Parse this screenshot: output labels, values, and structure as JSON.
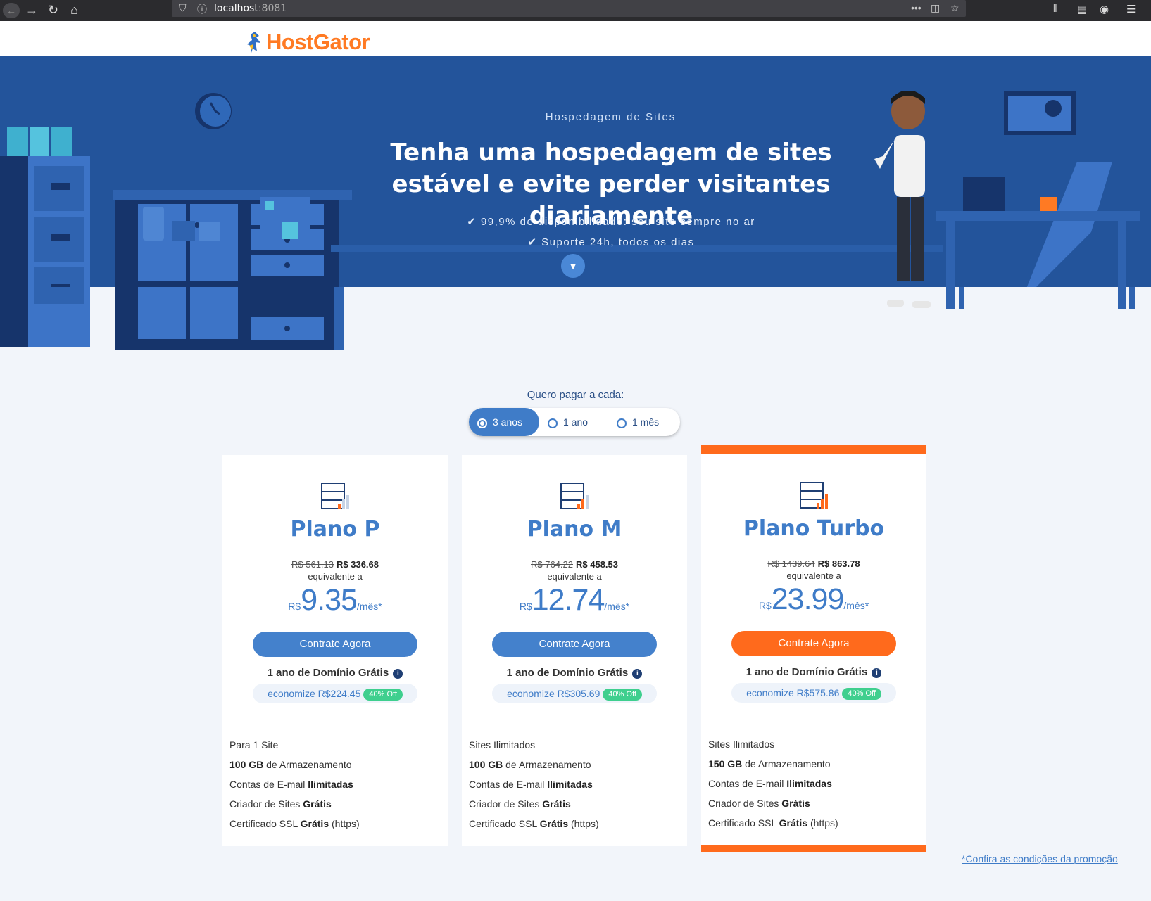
{
  "browser": {
    "url_host": "localhost",
    "url_port": ":8081"
  },
  "logo": {
    "text": "HostGator"
  },
  "hero": {
    "subtitle": "Hospedagem de Sites",
    "title": "Tenha uma hospedagem de sites estável e evite perder visitantes diariamente",
    "features": [
      "99,9% de disponibilidade: seu site sempre no ar",
      "Suporte 24h, todos os dias"
    ]
  },
  "billing": {
    "label": "Quero pagar a cada:",
    "options": [
      "3 anos",
      "1 ano",
      "1 mês"
    ],
    "selected": "3 anos"
  },
  "plans": [
    {
      "name": "Plano P",
      "old_price": "R$ 561.13",
      "new_price": "R$ 336.68",
      "equiv": "equivalente a",
      "currency": "R$",
      "monthly": "9.35",
      "per": "/mês*",
      "cta": "Contrate Agora",
      "domain": "1 ano de Domínio Grátis",
      "save": "economize R$224.45",
      "badge": "40% Off",
      "features": [
        {
          "pre": "Para 1 Site",
          "bold": "",
          "post": ""
        },
        {
          "pre": "",
          "bold": "100 GB",
          "post": " de Armazenamento"
        },
        {
          "pre": "Contas de E-mail ",
          "bold": "Ilimitadas",
          "post": ""
        },
        {
          "pre": "Criador de Sites ",
          "bold": "Grátis",
          "post": ""
        },
        {
          "pre": "Certificado SSL ",
          "bold": "Grátis",
          "post": " (https)"
        }
      ]
    },
    {
      "name": "Plano M",
      "old_price": "R$ 764.22",
      "new_price": "R$ 458.53",
      "equiv": "equivalente a",
      "currency": "R$",
      "monthly": "12.74",
      "per": "/mês*",
      "cta": "Contrate Agora",
      "domain": "1 ano de Domínio Grátis",
      "save": "economize R$305.69",
      "badge": "40% Off",
      "features": [
        {
          "pre": "Sites Ilimitados",
          "bold": "",
          "post": ""
        },
        {
          "pre": "",
          "bold": "100 GB",
          "post": " de Armazenamento"
        },
        {
          "pre": "Contas de E-mail ",
          "bold": "Ilimitadas",
          "post": ""
        },
        {
          "pre": "Criador de Sites ",
          "bold": "Grátis",
          "post": ""
        },
        {
          "pre": "Certificado SSL ",
          "bold": "Grátis",
          "post": " (https)"
        }
      ]
    },
    {
      "name": "Plano Turbo",
      "old_price": "R$ 1439.64",
      "new_price": "R$ 863.78",
      "equiv": "equivalente a",
      "currency": "R$",
      "monthly": "23.99",
      "per": "/mês*",
      "cta": "Contrate Agora",
      "domain": "1 ano de Domínio Grátis",
      "save": "economize R$575.86",
      "badge": "40% Off",
      "features": [
        {
          "pre": "Sites Ilimitados",
          "bold": "",
          "post": ""
        },
        {
          "pre": "",
          "bold": "150 GB",
          "post": " de Armazenamento"
        },
        {
          "pre": "Contas de E-mail ",
          "bold": "Ilimitadas",
          "post": ""
        },
        {
          "pre": "Criador de Sites ",
          "bold": "Grátis",
          "post": ""
        },
        {
          "pre": "Certificado SSL ",
          "bold": "Grátis",
          "post": " (https)"
        }
      ]
    }
  ],
  "promo_link": "*Confira as condições da promoção",
  "colors": {
    "hero_blue": "#23549b",
    "accent_blue": "#3f7cc8",
    "orange": "#ff6a1c",
    "badge_green": "#3fcf8e"
  }
}
